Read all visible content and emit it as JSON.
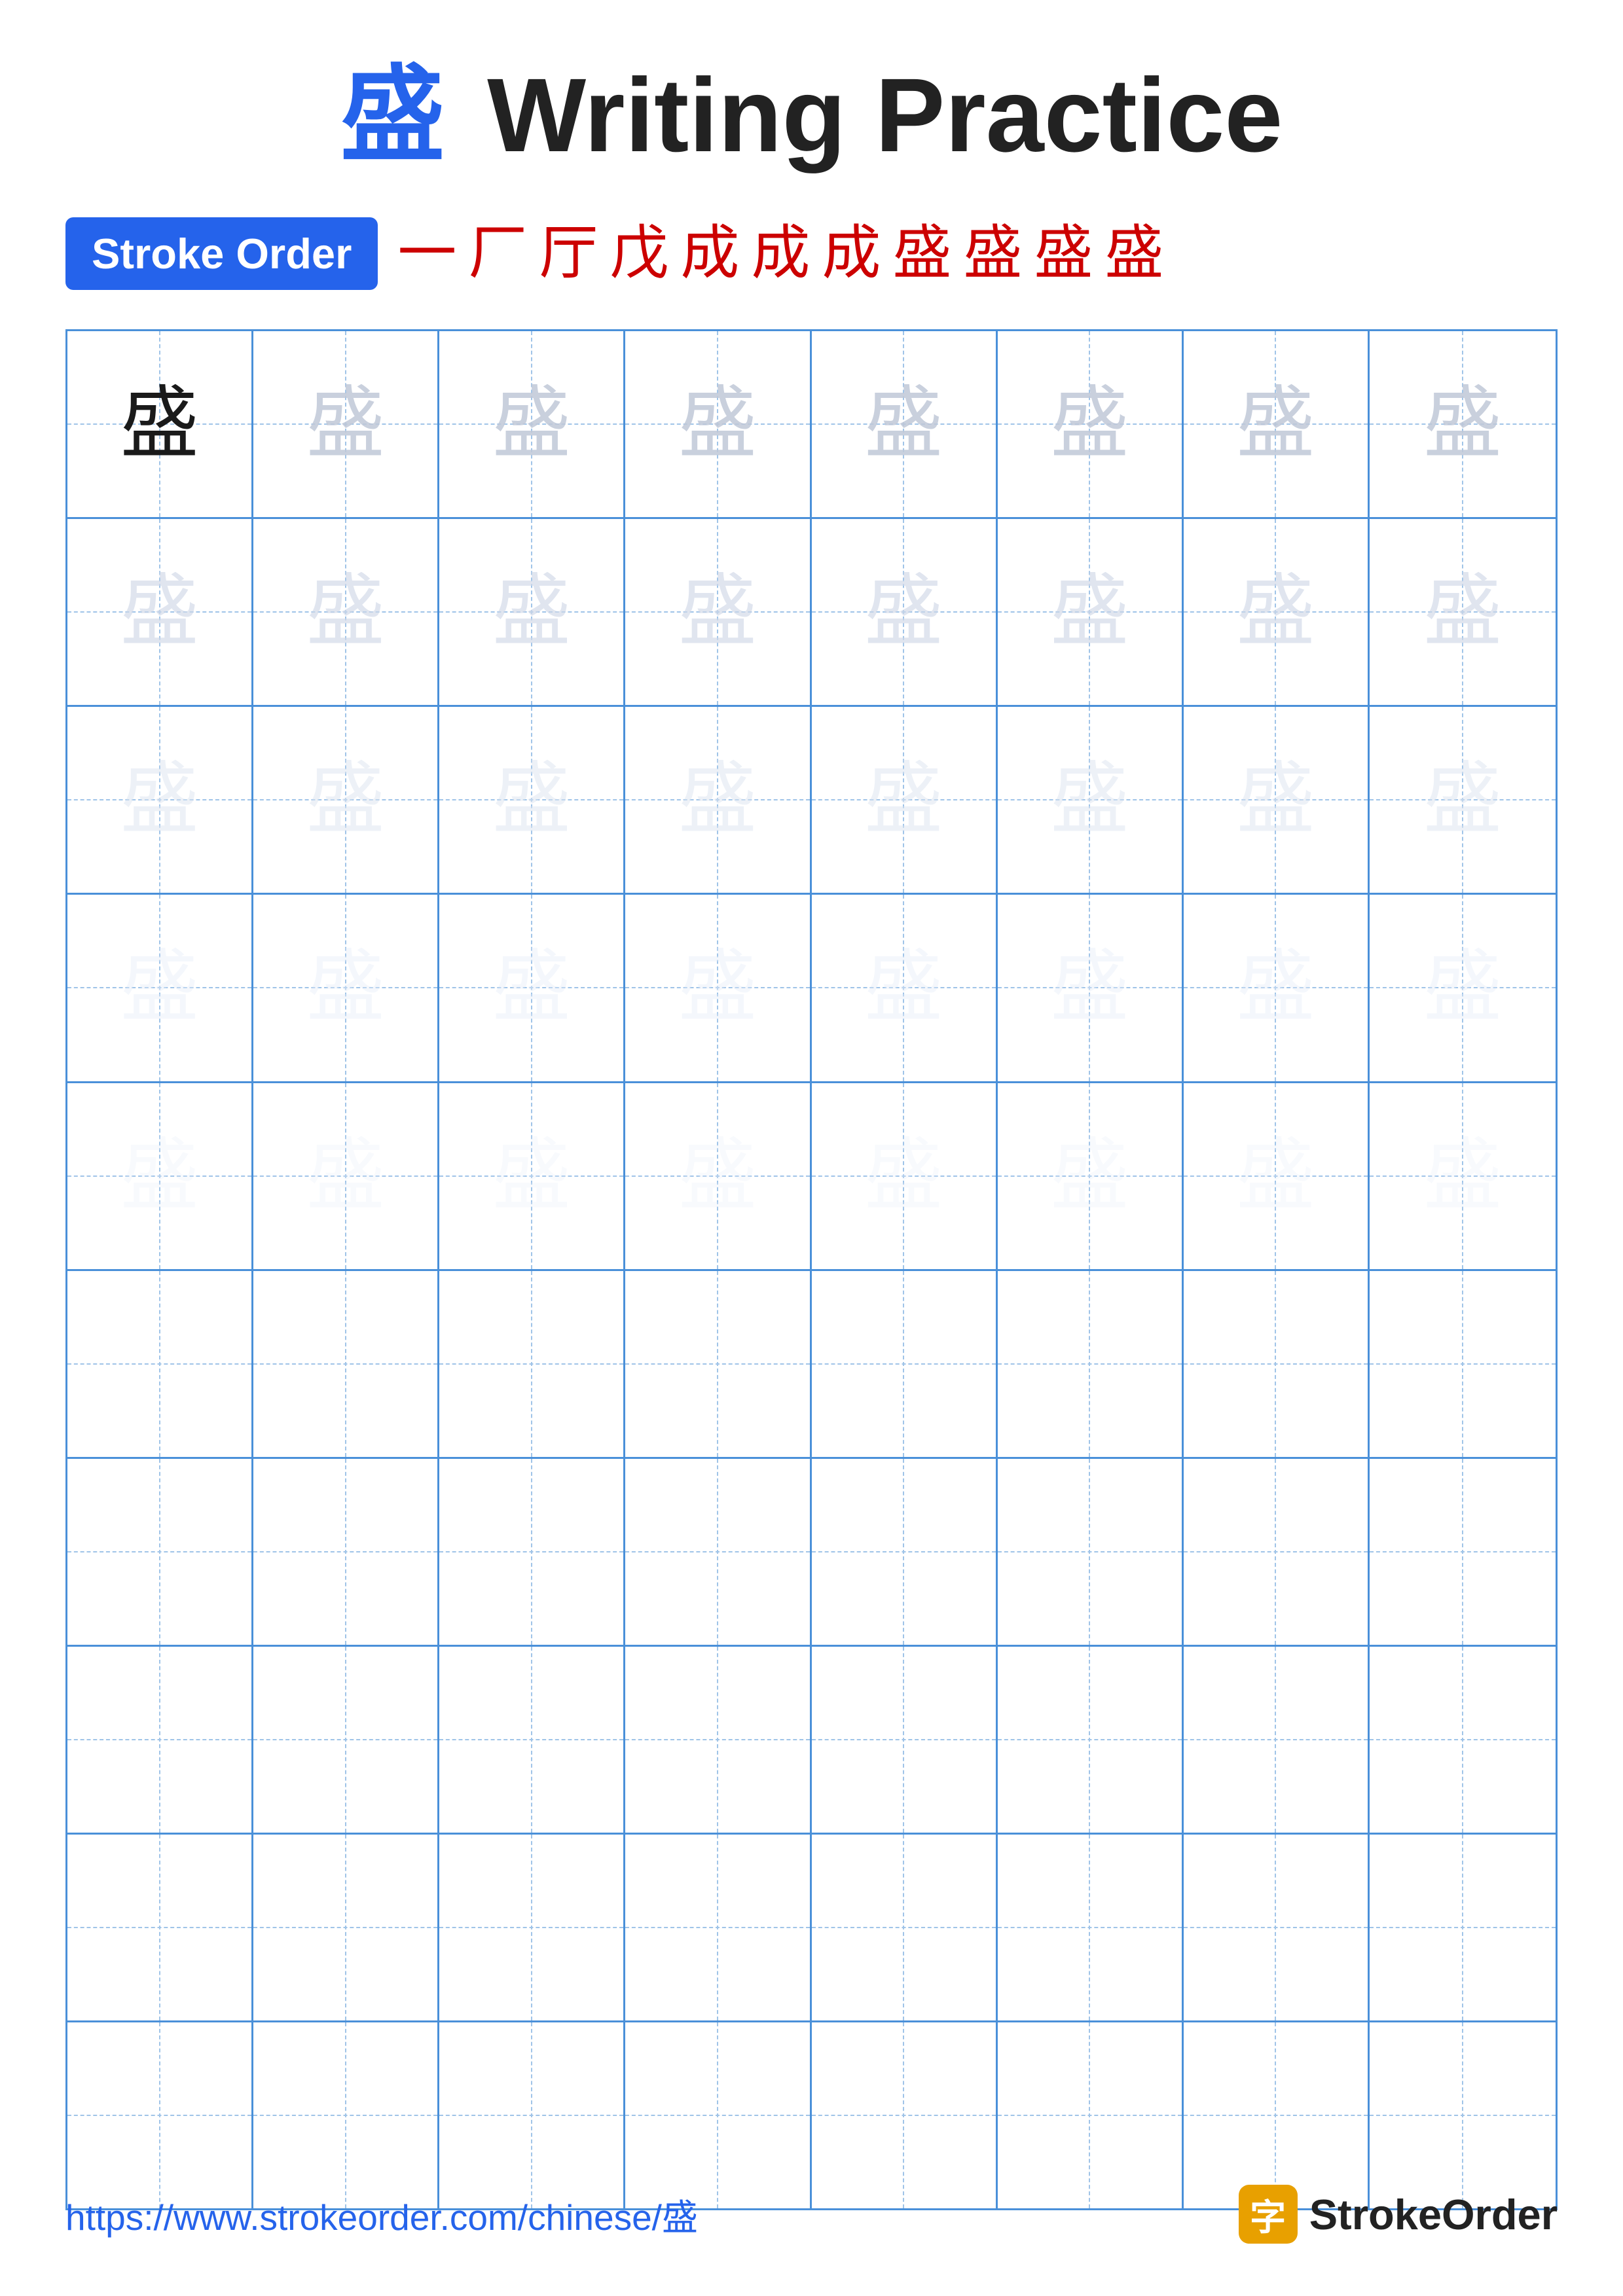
{
  "header": {
    "title_char": "盛",
    "title_text": " Writing Practice"
  },
  "stroke_order": {
    "badge_label": "Stroke Order",
    "strokes": [
      "一",
      "厂",
      "厅",
      "戊",
      "成",
      "成",
      "成",
      "盛",
      "盛",
      "盛",
      "盛"
    ]
  },
  "grid": {
    "rows": 10,
    "cols": 8,
    "char": "盛",
    "practice_rows": 5,
    "empty_rows": 5
  },
  "footer": {
    "url": "https://www.strokeorder.com/chinese/盛",
    "logo_icon": "字",
    "logo_text": "StrokeOrder"
  }
}
